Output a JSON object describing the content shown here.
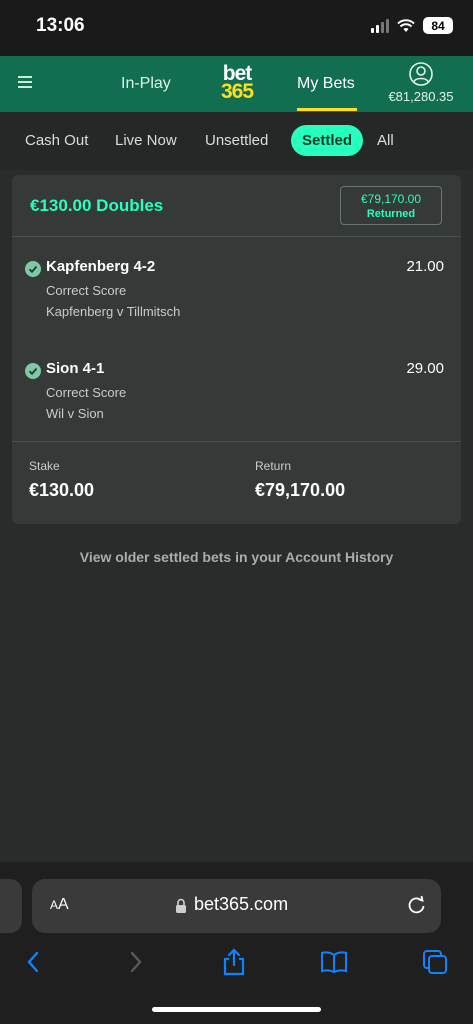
{
  "status_bar": {
    "time": "13:06",
    "battery": "84"
  },
  "header": {
    "inplay_label": "In-Play",
    "logo_top": "bet",
    "logo_bottom": "365",
    "mybets_label": "My Bets",
    "balance": "€81,280.35"
  },
  "tabs": [
    {
      "label": "Cash Out"
    },
    {
      "label": "Live Now"
    },
    {
      "label": "Unsettled"
    },
    {
      "label": "Settled",
      "active": true
    },
    {
      "label": "All"
    }
  ],
  "bet": {
    "title": "€130.00 Doubles",
    "returned_amount": "€79,170.00",
    "returned_label": "Returned",
    "selections": [
      {
        "name": "Kapfenberg 4-2",
        "odds": "21.00",
        "market": "Correct Score",
        "event": "Kapfenberg v Tillmitsch"
      },
      {
        "name": "Sion 4-1",
        "odds": "29.00",
        "market": "Correct Score",
        "event": "Wil v Sion"
      }
    ],
    "stake_label": "Stake",
    "stake_value": "€130.00",
    "return_label": "Return",
    "return_value": "€79,170.00"
  },
  "history_link": "View older settled bets in your Account History",
  "browser": {
    "aa_large": "A",
    "aa_small": "A",
    "url": "bet365.com"
  },
  "colors": {
    "accent": "#26ffbe",
    "header_green": "#126e51",
    "logo_yellow": "#ffdf1b",
    "ios_blue": "#0a84ff"
  }
}
